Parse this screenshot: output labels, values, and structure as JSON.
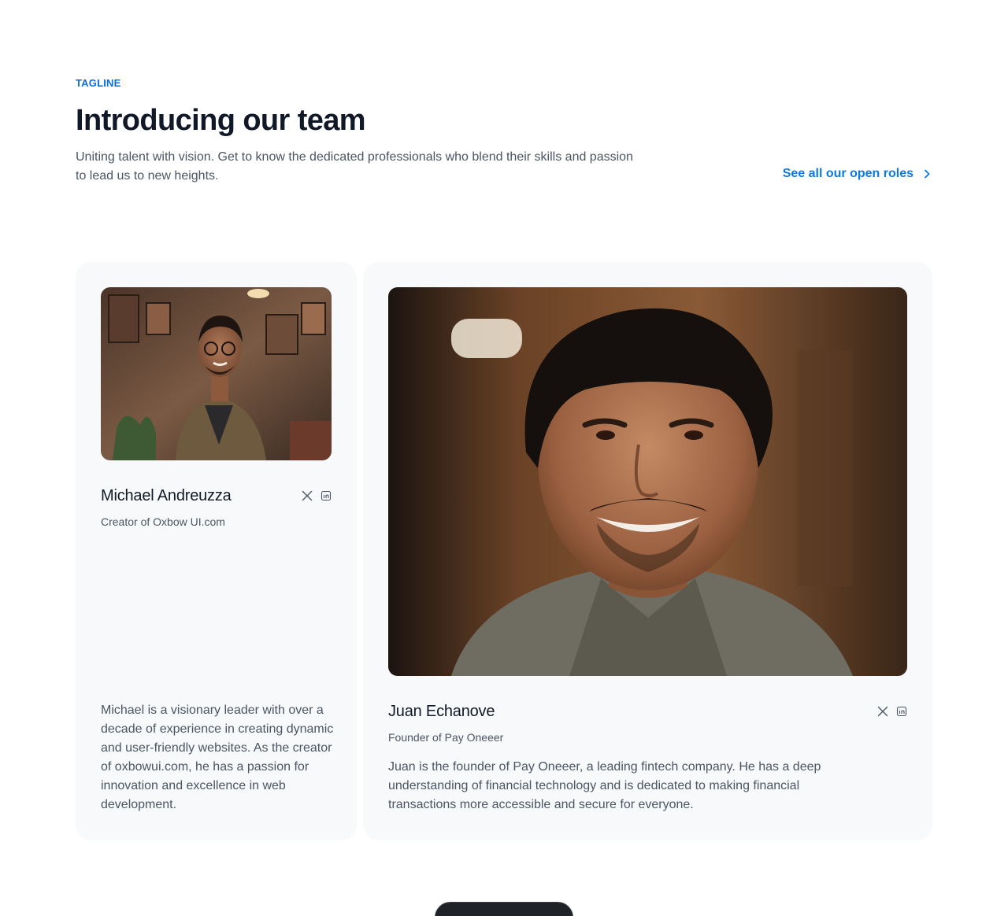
{
  "header": {
    "tagline": "TAGLINE",
    "title": "Introducing our team",
    "subtitle": "Uniting talent with vision. Get to know the dedicated professionals who blend their skills and passion to lead us to new heights.",
    "roles_link": "See all our open roles"
  },
  "team": [
    {
      "name": "Michael Andreuzza",
      "role": "Creator of Oxbow UI.com",
      "bio": "Michael is a visionary leader with over a decade of experience in creating dynamic and user-friendly websites. As the creator of oxbowui.com, he has a passion for innovation and excellence in web development."
    },
    {
      "name": "Juan Echanove",
      "role": "Founder of Pay Oneeer",
      "bio": "Juan is the founder of Pay Oneeer, a leading fintech company. He has a deep understanding of financial technology and is dedicated to making financial transactions more accessible and secure for everyone."
    }
  ],
  "icons": {
    "social_x": "x-icon",
    "social_linkedin": "linkedin-icon",
    "chevron": "chevron-right-icon"
  },
  "colors": {
    "accent": "#0b7ae6",
    "tagline": "#0b6ee0",
    "card_bg": "#f8f9fb",
    "text_primary": "#111827",
    "text_secondary": "#4b5563"
  }
}
